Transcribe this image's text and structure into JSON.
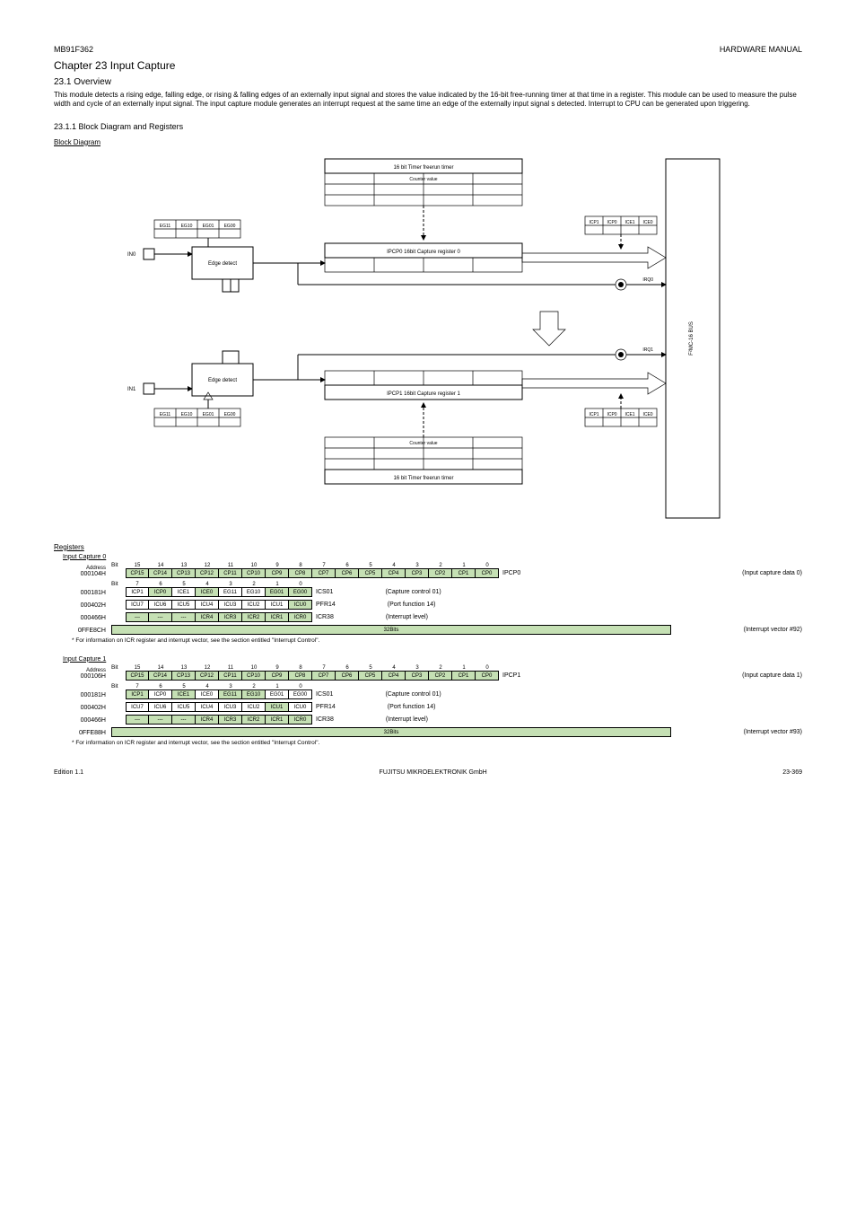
{
  "header": {
    "left_top": "MB91F362",
    "right_top": "HARDWARE MANUAL",
    "chapter": "Chapter 23 Input Capture",
    "section": "23.1 Overview",
    "intro": "This module detects a rising edge, falling edge, or rising & falling edges of an externally input signal and stores the value indicated by the 16-bit free-running timer at that time in a register. This module can be used to measure the pulse width and cycle of an externally input signal. The input capture module generates an interrupt request at the same time an edge of the externally input signal s detected. Interrupt to CPU can be generated upon triggering.",
    "subsec1": "23.1.1 Block Diagram and Registers",
    "block_label": "Block Diagram"
  },
  "diagram": {
    "edge_detect": "Edge detect",
    "capture_reg_0": "IPCP0 16bit Capture register 0",
    "capture_reg_1": "IPCP1 16bit Capture register 1",
    "timer": "16 bit Timer\nfreerun timer",
    "counter": "Counter value",
    "bus": "F²MC-16 BUS",
    "in0": "IN0",
    "in1": "IN1",
    "irq0": "IRQ0",
    "irq1": "IRQ1",
    "eg": [
      "EG11",
      "EG10",
      "EG01",
      "EG00"
    ],
    "ic": [
      "ICP1",
      "ICP0",
      "ICE1",
      "ICE0"
    ]
  },
  "regs_title": "Registers",
  "capture0": {
    "title": "Input Capture 0",
    "rows": [
      {
        "addr_label": "Address",
        "addr": "000104H",
        "bit": "Bit",
        "nums": [
          "15",
          "14",
          "13",
          "12",
          "11",
          "10",
          "9",
          "8",
          "7",
          "6",
          "5",
          "4",
          "3",
          "2",
          "1",
          "0"
        ],
        "cells": [
          "CP15",
          "CP14",
          "CP13",
          "CP12",
          "CP11",
          "CP10",
          "CP9",
          "CP8",
          "CP7",
          "CP6",
          "CP5",
          "CP4",
          "CP3",
          "CP2",
          "CP1",
          "CP0"
        ],
        "hl": [
          0,
          1,
          2,
          3,
          4,
          5,
          6,
          7,
          8,
          9,
          10,
          11,
          12,
          13,
          14,
          15
        ],
        "name": "IPCP0",
        "desc": "(Input capture data 0)"
      },
      {
        "addr": "000181H",
        "bit": "Bit",
        "nums": [
          "7",
          "6",
          "5",
          "4",
          "3",
          "2",
          "1",
          "0"
        ],
        "cells": [
          "ICP1",
          "ICP0",
          "ICE1",
          "ICE0",
          "EG11",
          "EG10",
          "EG01",
          "EG00"
        ],
        "hl": [
          1,
          3,
          6,
          7
        ],
        "name": "ICS01",
        "desc": "(Capture control 01)"
      },
      {
        "addr": "000402H",
        "nums": [],
        "cells": [
          "ICU7",
          "ICU6",
          "ICU5",
          "ICU4",
          "ICU3",
          "ICU2",
          "ICU1",
          "ICU0"
        ],
        "hl": [
          7
        ],
        "name": "PFR14",
        "desc": "(Port function 14)"
      },
      {
        "addr": "000466H",
        "nums": [],
        "cells": [
          "---",
          "---",
          "---",
          "ICR4",
          "ICR3",
          "ICR2",
          "ICR1",
          "ICR0"
        ],
        "hl": [
          0,
          1,
          2,
          3,
          4,
          5,
          6,
          7
        ],
        "name": "ICR38",
        "desc": "(Interrupt level)"
      }
    ],
    "vector_addr": "0FFE8CH",
    "vector_label": "32Bits",
    "vector_desc": "(Interrupt vector #92)"
  },
  "capture1": {
    "title": "Input Capture 1",
    "rows": [
      {
        "addr_label": "Address",
        "addr": "000106H",
        "bit": "Bit",
        "nums": [
          "15",
          "14",
          "13",
          "12",
          "11",
          "10",
          "9",
          "8",
          "7",
          "6",
          "5",
          "4",
          "3",
          "2",
          "1",
          "0"
        ],
        "cells": [
          "CP15",
          "CP14",
          "CP13",
          "CP12",
          "CP11",
          "CP10",
          "CP9",
          "CP8",
          "CP7",
          "CP6",
          "CP5",
          "CP4",
          "CP3",
          "CP2",
          "CP1",
          "CP0"
        ],
        "hl": [
          0,
          1,
          2,
          3,
          4,
          5,
          6,
          7,
          8,
          9,
          10,
          11,
          12,
          13,
          14,
          15
        ],
        "name": "IPCP1",
        "desc": "(Input capture data 1)"
      },
      {
        "addr": "000181H",
        "bit": "Bit",
        "nums": [
          "7",
          "6",
          "5",
          "4",
          "3",
          "2",
          "1",
          "0"
        ],
        "cells": [
          "ICP1",
          "ICP0",
          "ICE1",
          "ICE0",
          "EG11",
          "EG10",
          "EG01",
          "EG00"
        ],
        "hl": [
          0,
          2,
          4,
          5
        ],
        "name": "ICS01",
        "desc": "(Capture control 01)"
      },
      {
        "addr": "000402H",
        "nums": [],
        "cells": [
          "ICU7",
          "ICU6",
          "ICU5",
          "ICU4",
          "ICU3",
          "ICU2",
          "ICU1",
          "ICU0"
        ],
        "hl": [
          6
        ],
        "name": "PFR14",
        "desc": "(Port function 14)"
      },
      {
        "addr": "000466H",
        "nums": [],
        "cells": [
          "---",
          "---",
          "---",
          "ICR4",
          "ICR3",
          "ICR2",
          "ICR1",
          "ICR0"
        ],
        "hl": [
          0,
          1,
          2,
          3,
          4,
          5,
          6,
          7
        ],
        "name": "ICR38",
        "desc": "(Interrupt level)"
      }
    ],
    "vector_addr": "0FFE88H",
    "vector_label": "32Bits",
    "vector_desc": "(Interrupt vector #93)"
  },
  "footnote": "* For information on ICR register and interrupt vector, see the section entitled \"Interrupt Control\".",
  "footer": {
    "left": "Edition 1.1",
    "center": "FUJITSU MIKROELEKTRONIK GmbH",
    "right": "23-369"
  }
}
